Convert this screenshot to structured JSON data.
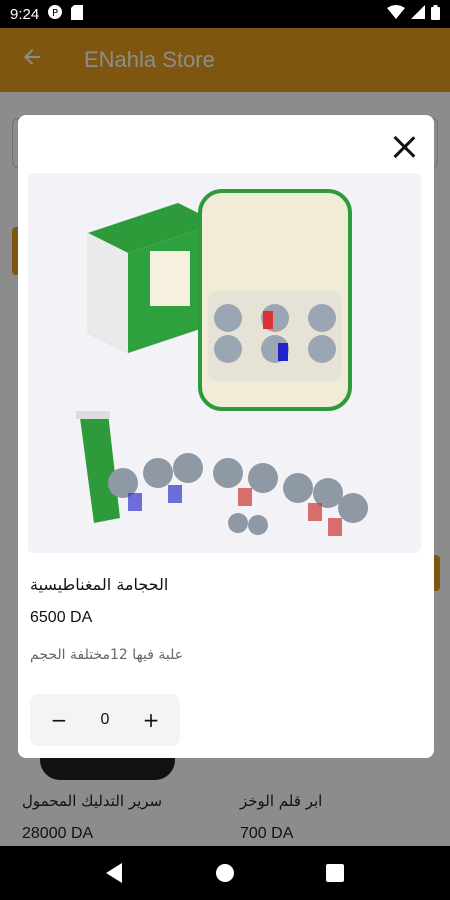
{
  "status_bar": {
    "time": "9:24"
  },
  "app_bar": {
    "title": "ENahla Store"
  },
  "background": {
    "products": [
      {
        "name": "سرير التدليك المحمول",
        "price": "28000 DA"
      },
      {
        "name": "ابر قلم الوخز",
        "price": "700 DA"
      }
    ]
  },
  "dialog": {
    "product_name": "الحجامة المغناطيسية",
    "price": "6500 DA",
    "description": "علبة فيها 12مختلفة الحجم",
    "quantity": "0",
    "minus_label": "−",
    "plus_label": "+"
  },
  "colors": {
    "accent": "#e59d1e"
  },
  "icons": [
    "back-arrow-icon",
    "close-icon",
    "nav-back-icon",
    "nav-home-icon",
    "nav-recents-icon"
  ]
}
